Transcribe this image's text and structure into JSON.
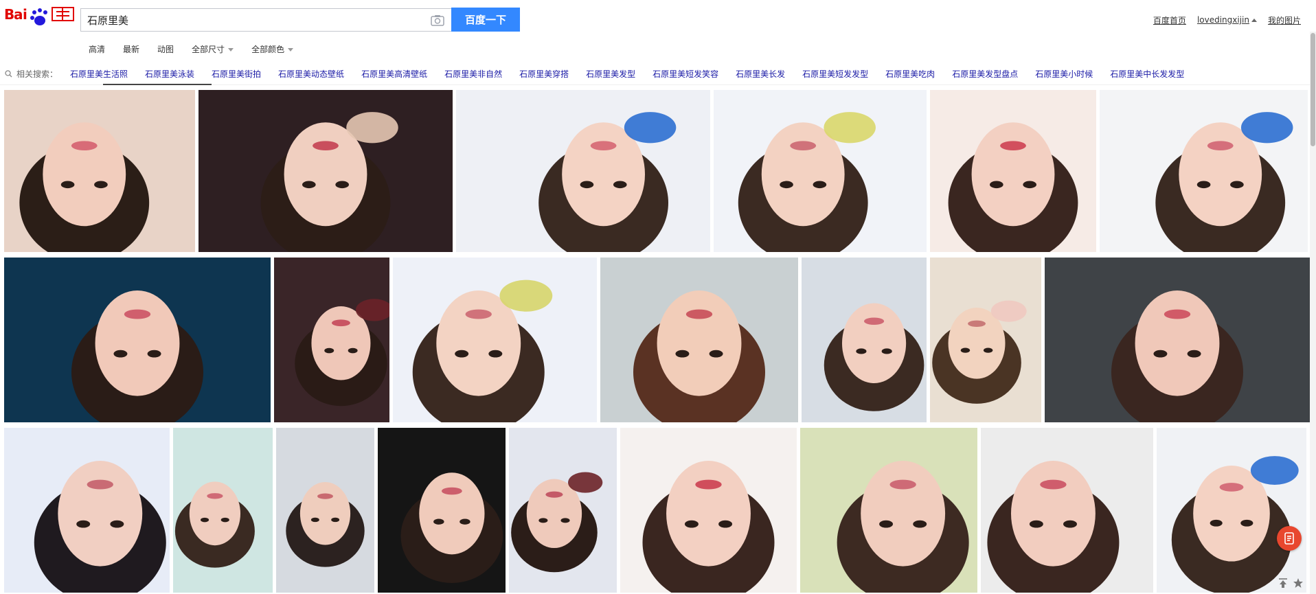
{
  "search": {
    "query": "石原里美",
    "button_label": "百度一下"
  },
  "top_links": {
    "home": "百度首页",
    "username": "lovedingxijin",
    "my_images": "我的图片"
  },
  "filters": {
    "hd": "高清",
    "latest": "最新",
    "animated": "动图",
    "size": "全部尺寸",
    "color": "全部颜色"
  },
  "related": {
    "label": "相关搜索：",
    "items": [
      "石原里美生活照",
      "石原里美泳装",
      "石原里美街拍",
      "石原里美动态壁纸",
      "石原里美高清壁纸",
      "石原里美非自然",
      "石原里美穿搭",
      "石原里美发型",
      "石原里美短发笑容",
      "石原里美长发",
      "石原里美短发发型",
      "石原里美吃肉",
      "石原里美发型盘点",
      "石原里美小时候",
      "石原里美中长发发型"
    ]
  },
  "colors": {
    "accent": "#3388ff",
    "related_link": "#1a1aa6",
    "float_button": "#e8472e"
  },
  "grid_rows": [
    {
      "tiles": [
        {
          "bg": "#e8d3c7",
          "hair": "#2b1e17",
          "skin": "#f2cdbd",
          "lip": "#d86b77",
          "accent": ""
        },
        {
          "bg": "#2e1f22",
          "hair": "#2c1d17",
          "skin": "#f0cfc0",
          "lip": "#c94f5d",
          "accent": "#e6c7b3"
        },
        {
          "bg": "#eef0f5",
          "hair": "#3a2a22",
          "skin": "#f4d3c4",
          "lip": "#d9717b",
          "accent": "#2c6fd1"
        },
        {
          "bg": "#f1f3f8",
          "hair": "#3b2a22",
          "skin": "#f3d2c2",
          "lip": "#d0727a",
          "accent": "#d9d76a"
        },
        {
          "bg": "#f6ebe6",
          "hair": "#3a2620",
          "skin": "#f3d0c2",
          "lip": "#d24f5d",
          "accent": ""
        },
        {
          "bg": "#f3f4f6",
          "hair": "#3a2a22",
          "skin": "#f4d2c3",
          "lip": "#d56f7b",
          "accent": "#2c6fd1"
        }
      ]
    },
    {
      "tiles": [
        {
          "bg": "#0e3550",
          "hair": "#2a1c17",
          "skin": "#f1c9b9",
          "lip": "#d05f6d",
          "accent": ""
        },
        {
          "bg": "#3a2528",
          "hair": "#2a1b16",
          "skin": "#efc7b8",
          "lip": "#c95563",
          "accent": "#6c2228"
        },
        {
          "bg": "#eef1f8",
          "hair": "#3b2a22",
          "skin": "#f3d3c3",
          "lip": "#d0727a",
          "accent": "#d6d56a"
        },
        {
          "bg": "#c9d0d2",
          "hair": "#5a3223",
          "skin": "#f2cdb9",
          "lip": "#cc5a62",
          "accent": ""
        },
        {
          "bg": "#d7dde4",
          "hair": "#3b2a22",
          "skin": "#f2cfc0",
          "lip": "#d06a75",
          "accent": ""
        },
        {
          "bg": "#e9dfd2",
          "hair": "#4a3424",
          "skin": "#f2d3bf",
          "lip": "#c97a78",
          "accent": "#f0c9c0"
        },
        {
          "bg": "#3f4347",
          "hair": "#3a2620",
          "skin": "#f0c8b9",
          "lip": "#d15a67",
          "accent": ""
        }
      ]
    },
    {
      "tiles": [
        {
          "bg": "#e7ecf7",
          "hair": "#1f1a1f",
          "skin": "#f1cfc2",
          "lip": "#c96b74",
          "accent": ""
        },
        {
          "bg": "#cfe6e2",
          "hair": "#3a2a22",
          "skin": "#f0cdbf",
          "lip": "#d06a76",
          "accent": ""
        },
        {
          "bg": "#d6dae0",
          "hair": "#2c2220",
          "skin": "#efcdbd",
          "lip": "#c96a70",
          "accent": ""
        },
        {
          "bg": "#151515",
          "hair": "#2a1d18",
          "skin": "#f0cbbb",
          "lip": "#cc5f6c",
          "accent": ""
        },
        {
          "bg": "#e3e6ee",
          "hair": "#2b1d18",
          "skin": "#efcabb",
          "lip": "#c45a67",
          "accent": "#6b2227"
        },
        {
          "bg": "#f5f1ef",
          "hair": "#3a2620",
          "skin": "#f3d0c2",
          "lip": "#d04e5c",
          "accent": ""
        },
        {
          "bg": "#d9e1b9",
          "hair": "#3d2a22",
          "skin": "#f1cdbe",
          "lip": "#ce6a76",
          "accent": ""
        },
        {
          "bg": "#ececec",
          "hair": "#3a2620",
          "skin": "#f2cdbf",
          "lip": "#cf5d6c",
          "accent": ""
        },
        {
          "bg": "#f0f2f5",
          "hair": "#3a2a22",
          "skin": "#f4d2c3",
          "lip": "#d56f7b",
          "accent": "#2c6fd1"
        }
      ]
    }
  ]
}
